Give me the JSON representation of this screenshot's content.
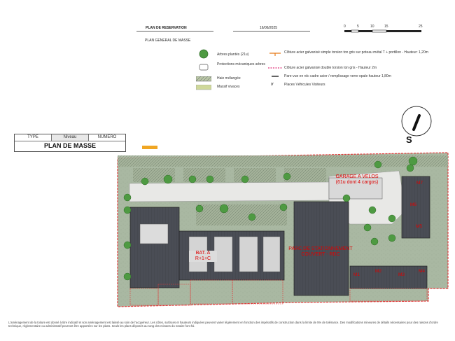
{
  "header": {
    "plan_title": "PLAN DE RESERVATION",
    "date": "16/06/2025",
    "subtitle": "PLAN GENERAL DE MASSE",
    "scale_ticks": [
      "0",
      "5",
      "10",
      "15",
      "25"
    ]
  },
  "legend": {
    "items": [
      {
        "icon": "tree-icon",
        "text": "Arbres plantés (21u)"
      },
      {
        "icon": "protection-icon",
        "text": "Protections mécaniques arbres"
      },
      {
        "icon": "hedge-icon",
        "text": "Haie mélangée"
      },
      {
        "icon": "flower-bed-icon",
        "text": "Massif vivaces"
      }
    ],
    "items_right": [
      {
        "icon": "fence-orange-icon",
        "text": "Clôture acier galvanisé simple torsion ton gris sur poteau métal T + portillon - Hauteur: 1,20m"
      },
      {
        "icon": "fence-pink-icon",
        "text": "Clôture acier galvanisé double torsion ton gris - Hauteur 2m"
      },
      {
        "icon": "screen-icon",
        "text": "Pare-vue en rdc cadre acier / remplissage verre opale hauteur 1,80m"
      },
      {
        "icon": "v-icon",
        "glyph": "V",
        "text": "Places Véhicules Visiteurs"
      }
    ]
  },
  "north": {
    "label": "S"
  },
  "title_block": {
    "col_type": "TYPE",
    "col_niveau": "Niveau",
    "col_numero": "NUMERO",
    "title": "PLAN DE MASSE"
  },
  "plan": {
    "garage_label": "GARAGE A VELOS\n(61u dont 4 cargos)",
    "building_label": "BAT. A\nR+1+C",
    "parking_label": "PARC DE STATIONNEMENT\nCOUVERT - RDC",
    "units": [
      "M1",
      "M2",
      "M3",
      "M4",
      "M5",
      "M6",
      "M7"
    ]
  },
  "footer": {
    "note": "L'aménagement de la toiture est donné à titre indicatif et son aménagement est laissé au soin de l'acquéreur. Les côtes, surfaces et hauteurs indiquées peuvent varier légèrement en fonction des impératifs de construction dans la limite de 5% de tolérance. Des modifications mineures de détails nécessaires pour des raisons d'ordre technique, réglementaire ou administratif pourront être apportées sur les plans. Seuls les plans déposés au rang des minutes du notaire font foi."
  },
  "colors": {
    "lawn": "#a9b8a2",
    "roof": "#4a4d55",
    "boundary": "#e23a3a",
    "tree": "#4e9a42",
    "paving": "#e8e8e6"
  }
}
